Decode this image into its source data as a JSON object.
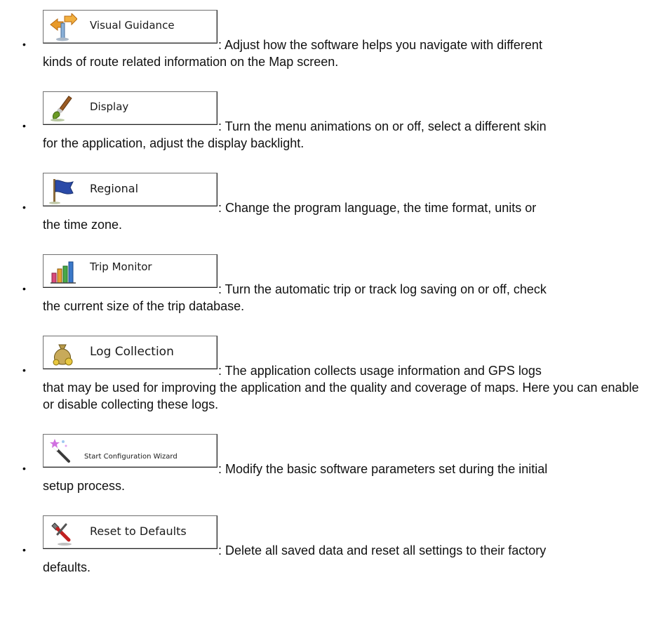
{
  "items": [
    {
      "button_label": "Visual Guidance",
      "icon": "signpost-arrows-icon",
      "line1": ": Adjust how the software helps you navigate with different",
      "rest": "kinds of route related information on the Map screen."
    },
    {
      "button_label": "Display",
      "icon": "paintbrush-icon",
      "line1": ": Turn the menu animations on or off, select a different skin",
      "rest": "for the application, adjust the display backlight."
    },
    {
      "button_label": "Regional",
      "icon": "blue-flag-icon",
      "line1": ": Change the program language, the time format, units or",
      "rest": "the time zone."
    },
    {
      "button_label": "Trip Monitor",
      "icon": "bar-chart-icon",
      "line1": ": Turn the automatic trip or track log saving on or off, check",
      "rest": "the current size of the trip database."
    },
    {
      "button_label": "Log Collection",
      "icon": "money-bag-icon",
      "line1": ": The application collects usage information and GPS logs",
      "rest": "that may be used for improving the application and the quality and coverage of maps. Here you can enable or disable collecting these logs."
    },
    {
      "button_label": "Start Configuration Wizard",
      "icon": "magic-wand-icon",
      "line1": ": Modify the basic software parameters set during the initial",
      "rest": "setup process."
    },
    {
      "button_label": "Reset to Defaults",
      "icon": "reset-tools-icon",
      "line1": ": Delete all saved data and reset all settings to their factory",
      "rest": "defaults."
    }
  ],
  "bullet_char": "•"
}
